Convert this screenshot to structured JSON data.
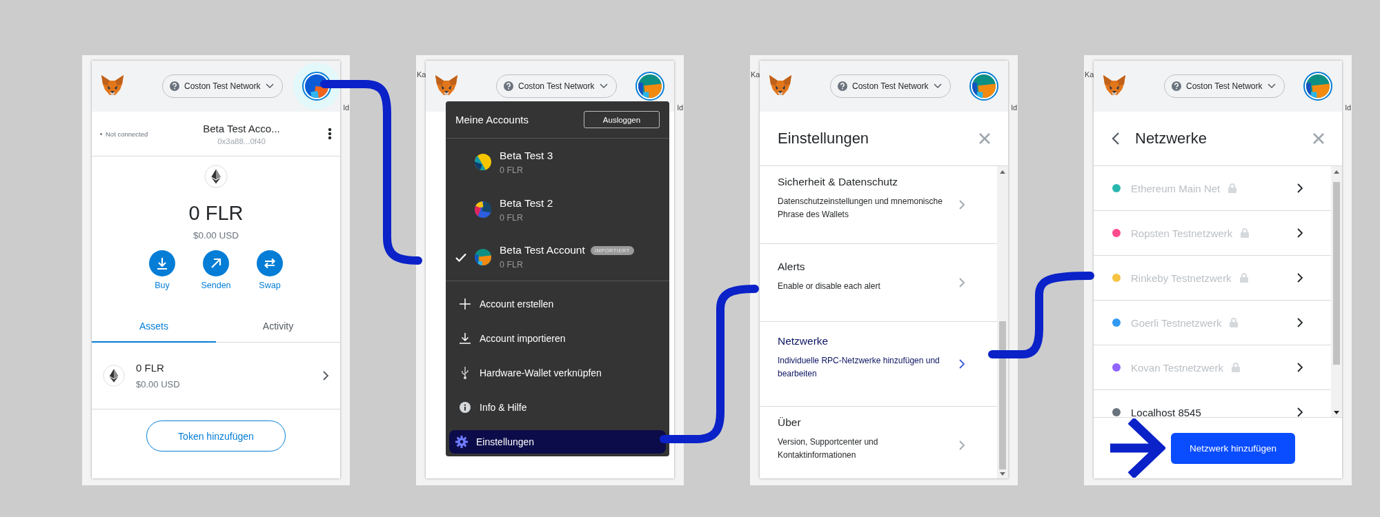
{
  "panels": [
    {
      "kind": "wallet",
      "backdrop": {
        "right_text": "ld"
      },
      "header": {
        "network": "Coston Test Network",
        "avatar_highlighted": true
      },
      "account": {
        "status": "Not connected",
        "name": "Beta Test Acco...",
        "address": "0x3a88...0f40"
      },
      "balance": {
        "amount": "0 FLR",
        "fiat": "$0.00 USD"
      },
      "actions": [
        {
          "label": "Buy"
        },
        {
          "label": "Senden"
        },
        {
          "label": "Swap"
        }
      ],
      "tabs": [
        {
          "label": "Assets",
          "selected": true
        },
        {
          "label": "Activity",
          "selected": false
        }
      ],
      "assets": [
        {
          "amount": "0 FLR",
          "fiat": "$0.00 USD"
        }
      ],
      "add_token_button": "Token hinzufügen"
    },
    {
      "kind": "account_menu",
      "backdrop": {
        "left_text": "Ka",
        "right_text": "ld"
      },
      "header": {
        "network": "Coston Test Network",
        "avatar_highlighted": false
      },
      "menu": {
        "title": "Meine Accounts",
        "logout_button": "Ausloggen",
        "accounts": [
          {
            "name": "Beta Test 3",
            "balance": "0 FLR",
            "selected": false
          },
          {
            "name": "Beta Test 2",
            "balance": "0 FLR",
            "selected": false
          },
          {
            "name": "Beta Test Account",
            "balance": "0 FLR",
            "selected": true,
            "badge": "IMPORTIERT"
          }
        ],
        "items": [
          {
            "label": "Account erstellen",
            "selected": false
          },
          {
            "label": "Account importieren",
            "selected": false
          },
          {
            "label": "Hardware-Wallet verknüpfen",
            "selected": false
          },
          {
            "label": "Info & Hilfe",
            "selected": false
          },
          {
            "label": "Einstellungen",
            "selected": true
          }
        ]
      }
    },
    {
      "kind": "settings",
      "backdrop": {
        "left_text": "Ka",
        "right_text": "ld"
      },
      "header": {
        "network": "Coston Test Network",
        "avatar_highlighted": false
      },
      "title": "Einstellungen",
      "items": [
        {
          "title": "Sicherheit & Datenschutz",
          "description": "Datenschutzeinstellungen und mnemonische Phrase des Wallets",
          "selected": false
        },
        {
          "title": "Alerts",
          "description": "Enable or disable each alert",
          "selected": false
        },
        {
          "title": "Netzwerke",
          "description": "Individuelle RPC-Netzwerke hinzufügen und bearbeiten",
          "selected": true
        },
        {
          "title": "Über",
          "description": "Version, Supportcenter und Kontaktinformationen",
          "selected": false
        }
      ]
    },
    {
      "kind": "networks",
      "backdrop": {
        "left_text": "Ka",
        "right_text": "ld"
      },
      "header": {
        "network": "Coston Test Network",
        "avatar_highlighted": false
      },
      "title": "Netzwerke",
      "networks": [
        {
          "name": "Ethereum Main Net",
          "color": "#29b6af",
          "locked": true
        },
        {
          "name": "Ropsten Testnetzwerk",
          "color": "#ff4a8d",
          "locked": true
        },
        {
          "name": "Rinkeby Testnetzwerk",
          "color": "#f6c343",
          "locked": true
        },
        {
          "name": "Goerli Testnetzwerk",
          "color": "#3099f2",
          "locked": true
        },
        {
          "name": "Kovan Testnetzwerk",
          "color": "#9064ff",
          "locked": true
        },
        {
          "name": "Localhost 8545",
          "color": "#6a737d",
          "locked": false
        }
      ],
      "add_button": "Netzwerk hinzufügen"
    }
  ]
}
